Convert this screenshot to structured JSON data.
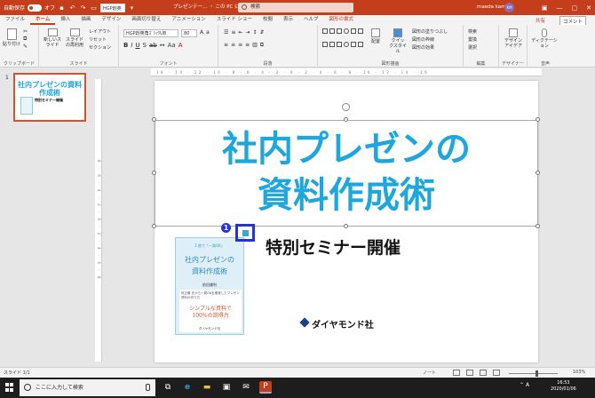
{
  "titlebar": {
    "autosave_label": "自動保存",
    "autosave_state": "オフ",
    "qat_font": "HGP創英",
    "doc_title": "プレゼンテー… ・ この PC に保存済み",
    "search_placeholder": "検索",
    "user_name": "maeda kamari",
    "avatar_initials": "KM"
  },
  "tabs": [
    "ファイル",
    "ホーム",
    "挿入",
    "描画",
    "デザイン",
    "画面切り替え",
    "アニメーション",
    "スライド ショー",
    "校閲",
    "表示",
    "ヘルプ",
    "図形の書式"
  ],
  "share_label": "共有",
  "comment_label": "コメント",
  "ribbon": {
    "clipboard": {
      "paste": "貼り付け",
      "label": "クリップボード"
    },
    "slides": {
      "new_slide": "新しいスライド",
      "reuse": "スライドの再利用",
      "layout": "レイアウト",
      "reset": "リセット",
      "section": "セクション",
      "label": "スライド"
    },
    "font": {
      "name": "HGP創英角ｺﾞｼｯｸUB",
      "size": "80",
      "label": "フォント"
    },
    "paragraph": {
      "label": "段落"
    },
    "drawing": {
      "arrange": "配置",
      "quick_styles": "クイックスタイル",
      "fill": "図形の塗りつぶし",
      "outline": "図形の枠線",
      "effects": "図形の効果",
      "label": "図形描画"
    },
    "editing": {
      "find": "検索",
      "replace": "置換",
      "select": "選択",
      "label": "編集"
    },
    "designer": {
      "ideas": "デザインアイデア",
      "label": "デザイナー"
    },
    "voice": {
      "dictate": "ディクテーション",
      "label": "音声"
    }
  },
  "thumbnail": {
    "number": "1",
    "title": "社内プレゼンの資料作成術",
    "subtitle": "特別セミナー開催"
  },
  "slide": {
    "title_line1": "社内プレゼンの",
    "title_line2": "資料作成術",
    "subtitle": "特別セミナー開催",
    "publisher": "ダイヤモンド社",
    "callout_number": "1",
    "book": {
      "tagline": "1 枚で「一発OK」",
      "title_line1": "社内プレゼンの",
      "title_line2": "資料作成術",
      "author": "前田鎌利",
      "description": "孫正義 氏から一発OKを連発したプレゼン資料の作り方",
      "highlight_line1": "シンプルな資料で",
      "highlight_line2": "100%の説得力",
      "publisher": "ダイヤモンド社"
    }
  },
  "rulers": {
    "horizontal": "16 · 14 · 12 · 10 · 8 · 6 · 4 · 2 · 0 · 2 · 4 · 6 · 8 · 10 · 12 · 14 · 16",
    "vertical": "8 · 6 · 4 · 2 · 0 · 2 · 4 · 6 · 8"
  },
  "statusbar": {
    "slide_info": "スライド 1/1",
    "notes": "ノート",
    "zoom": "103%"
  },
  "taskbar": {
    "search_placeholder": "ここに入力して検索",
    "ime": "A",
    "time": "16:53",
    "date": "2020/01/06"
  }
}
